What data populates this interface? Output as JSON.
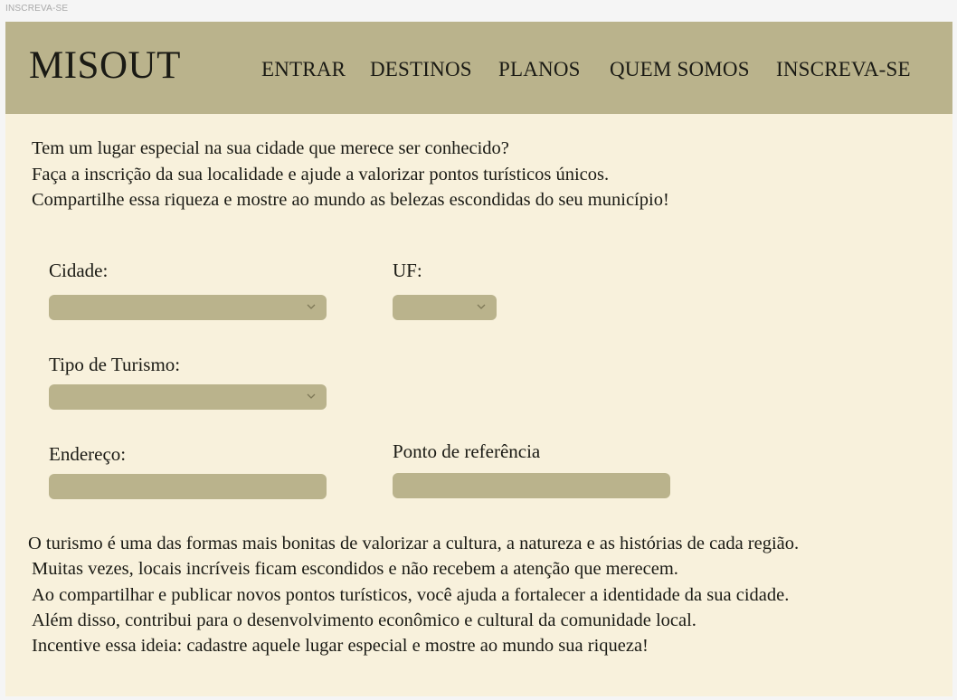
{
  "frame_label": "INSCREVA-SE",
  "brand": "MISOUT",
  "nav": [
    {
      "label": "ENTRAR"
    },
    {
      "label": "DESTINOS"
    },
    {
      "label": "PLANOS"
    },
    {
      "label": "QUEM SOMOS"
    },
    {
      "label": "INSCREVA-SE"
    }
  ],
  "intro": [
    "Tem um lugar especial na sua cidade que merece ser conhecido?",
    "Faça a inscrição da sua localidade e ajude a valorizar pontos turísticos únicos.",
    "Compartilhe essa riqueza e mostre ao mundo as belezas escondidas do seu município!"
  ],
  "form": {
    "city_label": "Cidade:",
    "city_value": "",
    "uf_label": "UF:",
    "uf_value": "",
    "tourism_label": "Tipo de Turismo:",
    "tourism_value": "",
    "address_label": "Endereço:",
    "address_value": "",
    "reference_label": "Ponto de referência",
    "reference_value": ""
  },
  "outro": [
    "O turismo é uma das formas mais bonitas de valorizar a cultura, a natureza e as histórias de cada região.",
    "Muitas vezes, locais incríveis ficam escondidos e não recebem a atenção que merecem.",
    "Ao compartilhar e publicar novos pontos turísticos, você ajuda a fortalecer a identidade da sua cidade.",
    "Além disso, contribui para o desenvolvimento econômico e cultural da comunidade local.",
    "Incentive essa ideia: cadastre aquele lugar especial e mostre ao mundo sua riqueza!"
  ],
  "icons": {
    "select": "chevron-down-icon"
  },
  "colors": {
    "header": "#bab38c",
    "page": "#f8f1dc",
    "field": "#bab38c",
    "text": "#1a1a14"
  }
}
